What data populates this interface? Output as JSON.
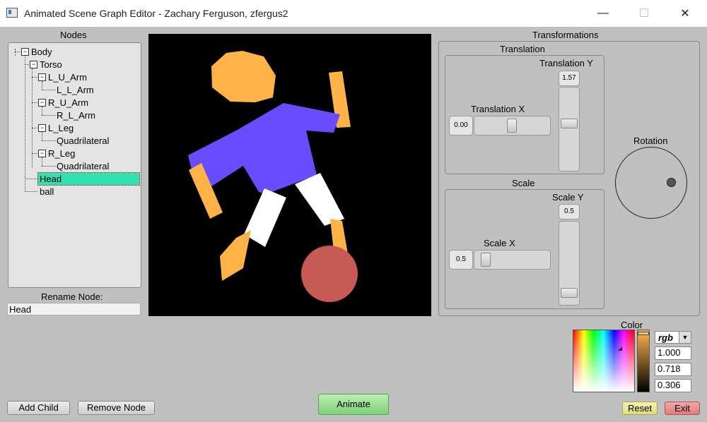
{
  "window": {
    "title": "Animated Scene Graph Editor - Zachary Ferguson, zfergus2",
    "minimize": "—",
    "maximize": "☐",
    "close": "✕"
  },
  "nodes_panel": {
    "label": "Nodes",
    "tree": [
      {
        "label": "Body",
        "toggle": "−"
      },
      {
        "label": "Torso",
        "toggle": "−"
      },
      {
        "label": "L_U_Arm",
        "toggle": "−"
      },
      {
        "label": "L_L_Arm"
      },
      {
        "label": "R_U_Arm",
        "toggle": "−"
      },
      {
        "label": "R_L_Arm"
      },
      {
        "label": "L_Leg",
        "toggle": "−"
      },
      {
        "label": "Quadrilateral"
      },
      {
        "label": "R_Leg",
        "toggle": "−"
      },
      {
        "label": "Quadrilateral"
      },
      {
        "label": "Head",
        "selected": true
      },
      {
        "label": "ball"
      }
    ],
    "rename_label": "Rename Node:",
    "rename_value": "Head"
  },
  "scene_colors": {
    "head": "#ffb347",
    "torso": "#6a4cff",
    "limb_upper_left": "#ffb347",
    "leg": "#ffffff",
    "ball": "#c85a55"
  },
  "transformations": {
    "label": "Transformations",
    "translation": {
      "label": "Translation",
      "x_label": "Translation X",
      "x_value": "0.00",
      "y_label": "Translation Y",
      "y_value": "1.57"
    },
    "scale": {
      "label": "Scale",
      "x_label": "Scale X",
      "x_value": "0.5",
      "y_label": "Scale Y",
      "y_value": "0.5"
    },
    "rotation": {
      "label": "Rotation"
    }
  },
  "color": {
    "label": "Color",
    "mode": "rgb",
    "r": "1.000",
    "g": "0.718",
    "b": "0.306",
    "current": "#ffb74e"
  },
  "buttons": {
    "add_child": "Add Child",
    "remove_node": "Remove Node",
    "animate": "Animate",
    "reset": "Reset",
    "exit": "Exit"
  }
}
